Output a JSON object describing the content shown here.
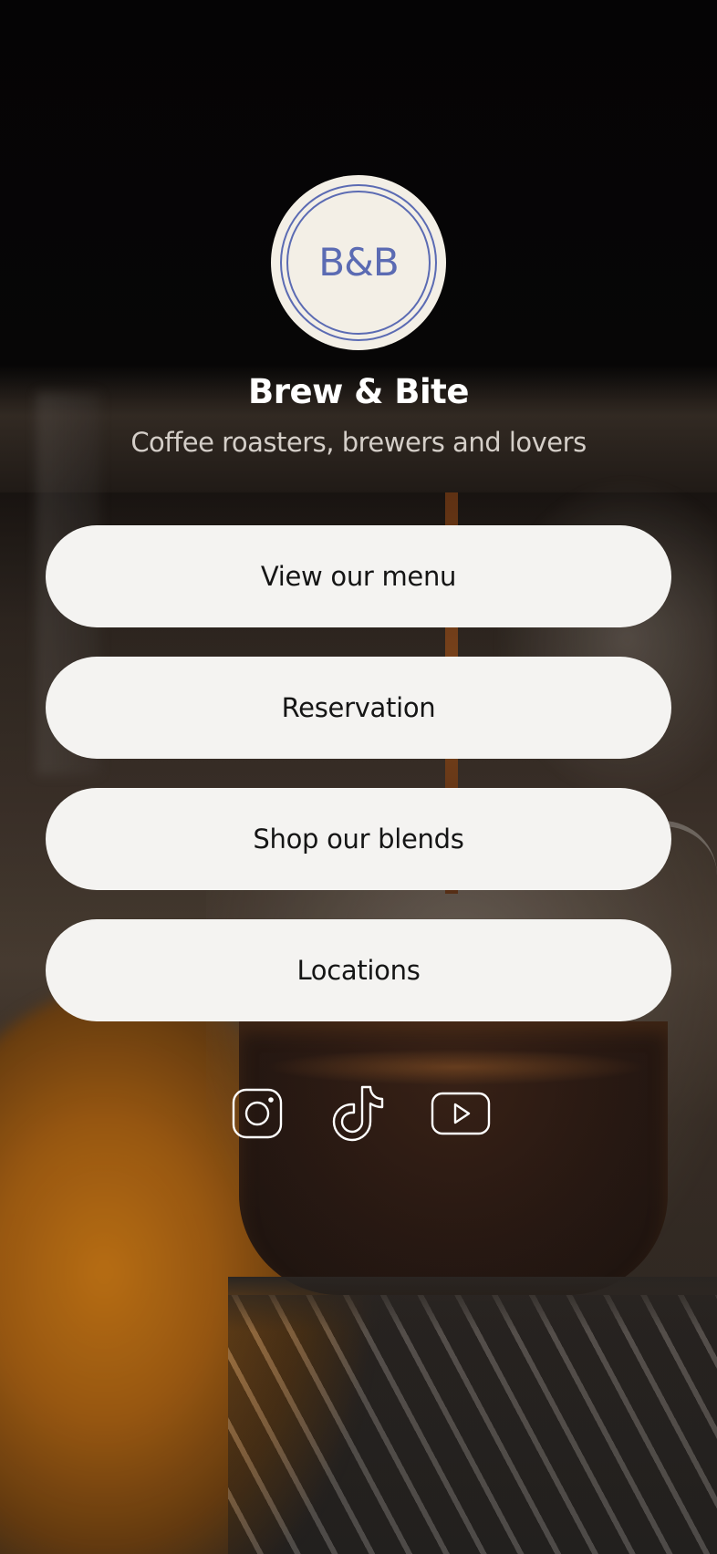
{
  "brand": {
    "logo_text": "B&B",
    "name": "Brew & Bite",
    "tagline": "Coffee roasters, brewers and lovers"
  },
  "links": [
    {
      "label": "View our menu"
    },
    {
      "label": "Reservation"
    },
    {
      "label": "Shop our blends"
    },
    {
      "label": "Locations"
    }
  ],
  "socials": [
    {
      "icon": "instagram-icon"
    },
    {
      "icon": "tiktok-icon"
    },
    {
      "icon": "youtube-icon"
    }
  ],
  "colors": {
    "logo_background": "#f3efe6",
    "logo_accent": "#5b6bb3",
    "button_background": "#f4f3f1",
    "button_text": "#151515",
    "title_text": "#ffffff",
    "subtitle_text": "#d4cec8"
  }
}
